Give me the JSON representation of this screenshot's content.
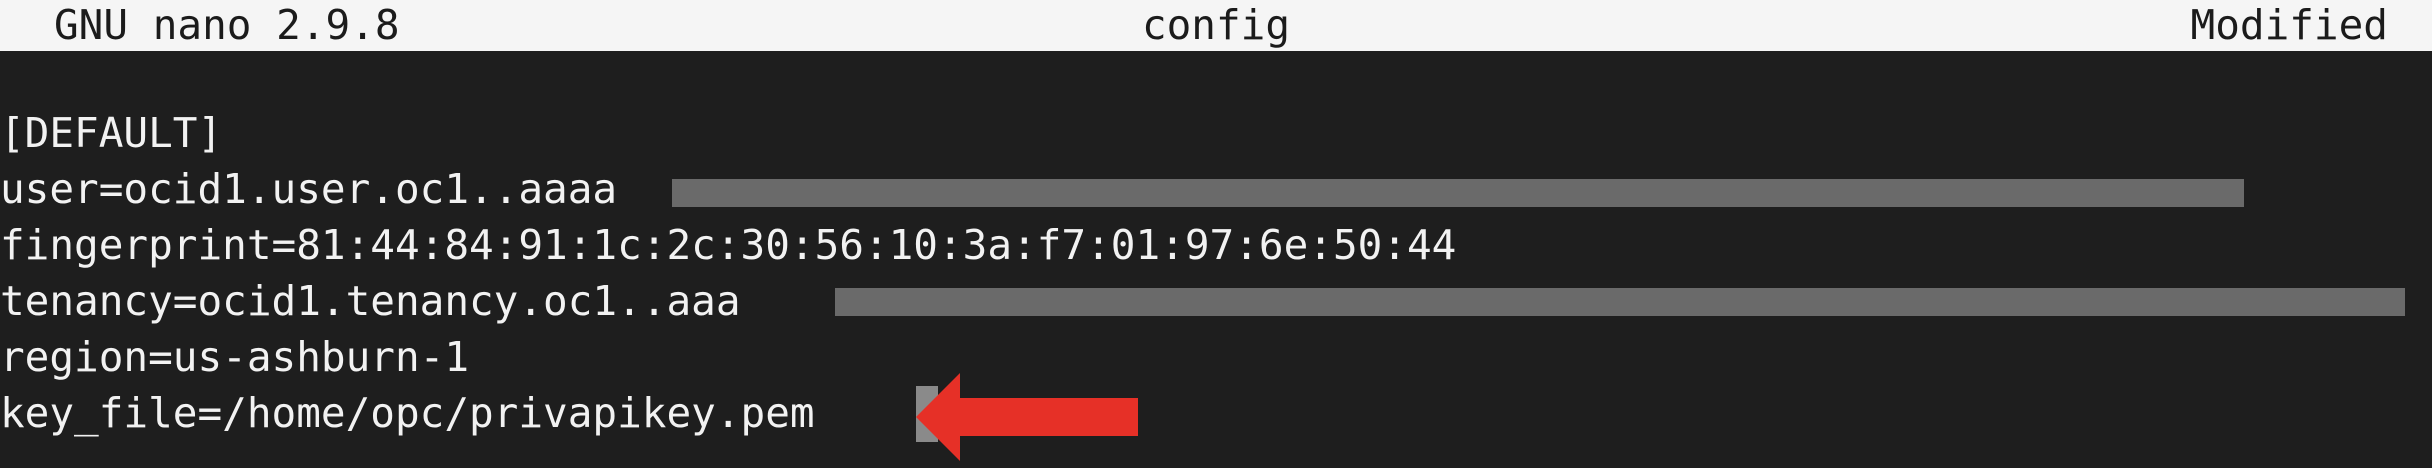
{
  "titlebar": {
    "app": "GNU nano 2.9.8",
    "file": "config",
    "status": "Modified"
  },
  "editor": {
    "lines": [
      "[DEFAULT]",
      "user=ocid1.user.oc1..aaaa",
      "fingerprint=81:44:84:91:1c:2c:30:56:10:3a:f7:01:97:6e:50:44",
      "tenancy=ocid1.tenancy.oc1..aaa",
      "region=us-ashburn-1",
      "key_file=/home/opc/privapikey.pem"
    ]
  },
  "annotation": {
    "arrow_color": "#e63027"
  }
}
